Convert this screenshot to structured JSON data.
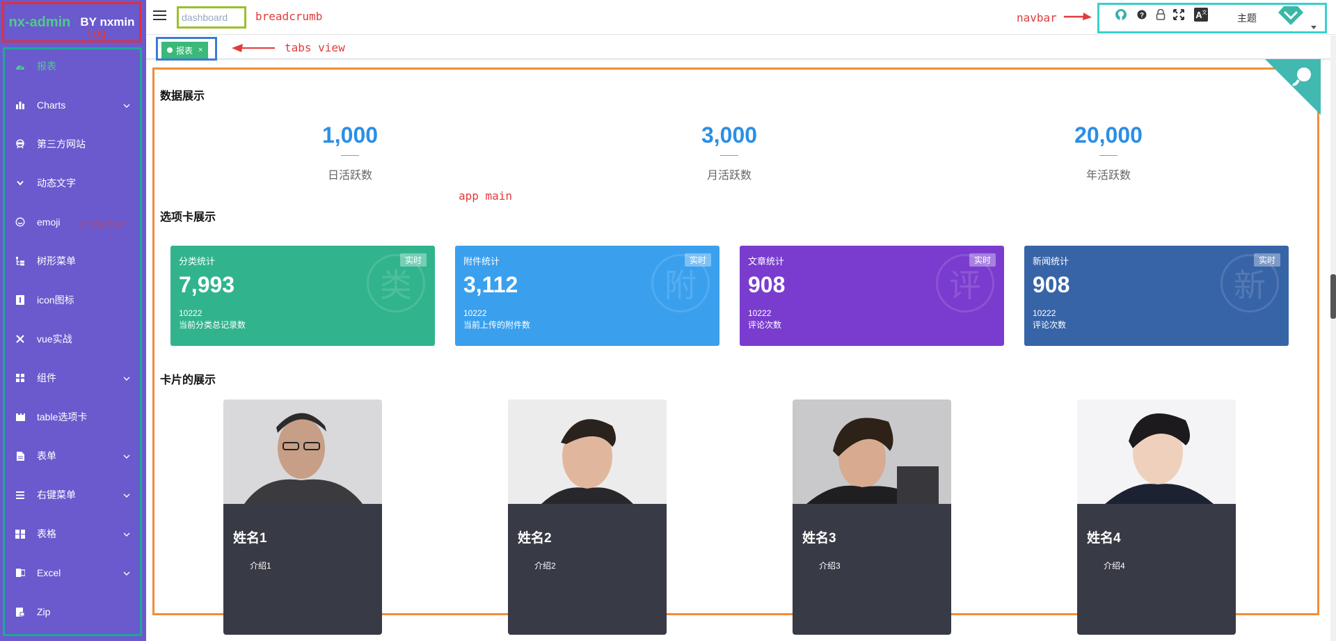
{
  "logo": {
    "name": "nx-admin",
    "by": "BY nxmin",
    "annotation": "log"
  },
  "annotations": {
    "breadcrumb": "breadcrumb",
    "navbar": "navbar",
    "tabs_view": "tabs view",
    "app_main": "app main",
    "sidebar": "sidebar"
  },
  "sidebar": {
    "items": [
      {
        "label": "报表",
        "icon": "dashboard-icon",
        "active": true,
        "has_children": false
      },
      {
        "label": "Charts",
        "icon": "bar-chart-icon",
        "has_children": true
      },
      {
        "label": "第三方网站",
        "icon": "link-icon",
        "has_children": false
      },
      {
        "label": "动态文字",
        "icon": "chevron-down-icon",
        "has_children": false
      },
      {
        "label": "emoji",
        "icon": "emoji-icon",
        "has_children": false
      },
      {
        "label": "树形菜单",
        "icon": "tree-icon",
        "has_children": false
      },
      {
        "label": "icon图标",
        "icon": "info-icon",
        "has_children": false
      },
      {
        "label": "vue实战",
        "icon": "close-icon",
        "has_children": false
      },
      {
        "label": "组件",
        "icon": "component-icon",
        "has_children": true
      },
      {
        "label": "table选项卡",
        "icon": "tab-icon",
        "has_children": false
      },
      {
        "label": "表单",
        "icon": "form-icon",
        "has_children": true
      },
      {
        "label": "右键菜单",
        "icon": "list-icon",
        "has_children": true
      },
      {
        "label": "表格",
        "icon": "table-icon",
        "has_children": true
      },
      {
        "label": "Excel",
        "icon": "excel-icon",
        "has_children": true
      },
      {
        "label": "Zip",
        "icon": "zip-icon",
        "has_children": false
      }
    ]
  },
  "breadcrumb": {
    "label": "dashboard"
  },
  "navbar": {
    "theme_label": "主题"
  },
  "tabs": [
    {
      "label": "报表",
      "close": "×"
    }
  ],
  "main": {
    "sections": {
      "data": "数据展示",
      "tabs": "选项卡展示",
      "cards": "卡片的展示"
    },
    "stats": [
      {
        "value": "1,000",
        "label": "日活跃数"
      },
      {
        "value": "3,000",
        "label": "月活跃数"
      },
      {
        "value": "20,000",
        "label": "年活跃数"
      }
    ],
    "stat_cards": [
      {
        "title": "分类统计",
        "badge": "实时",
        "value": "7,993",
        "sub_value": "10222",
        "sub_label": "当前分类总记录数",
        "watermark": "类",
        "color": "#31b48d"
      },
      {
        "title": "附件统计",
        "badge": "实时",
        "value": "3,112",
        "sub_value": "10222",
        "sub_label": "当前上传的附件数",
        "watermark": "附",
        "color": "#3aa0ee"
      },
      {
        "title": "文章统计",
        "badge": "实时",
        "value": "908",
        "sub_value": "10222",
        "sub_label": "评论次数",
        "watermark": "评",
        "color": "#7a3ccf"
      },
      {
        "title": "新闻统计",
        "badge": "实时",
        "value": "908",
        "sub_value": "10222",
        "sub_label": "评论次数",
        "watermark": "新",
        "color": "#3764a7"
      }
    ],
    "people": [
      {
        "name": "姓名1",
        "intro": "介绍1"
      },
      {
        "name": "姓名2",
        "intro": "介绍2"
      },
      {
        "name": "姓名3",
        "intro": "介绍3"
      },
      {
        "name": "姓名4",
        "intro": "介绍4"
      }
    ]
  },
  "colors": {
    "sidebar_bg": "#6a5acd",
    "accent": "#4ecb8b",
    "stat_number": "#2a8fe6",
    "tag_bg": "#3ab97a"
  }
}
